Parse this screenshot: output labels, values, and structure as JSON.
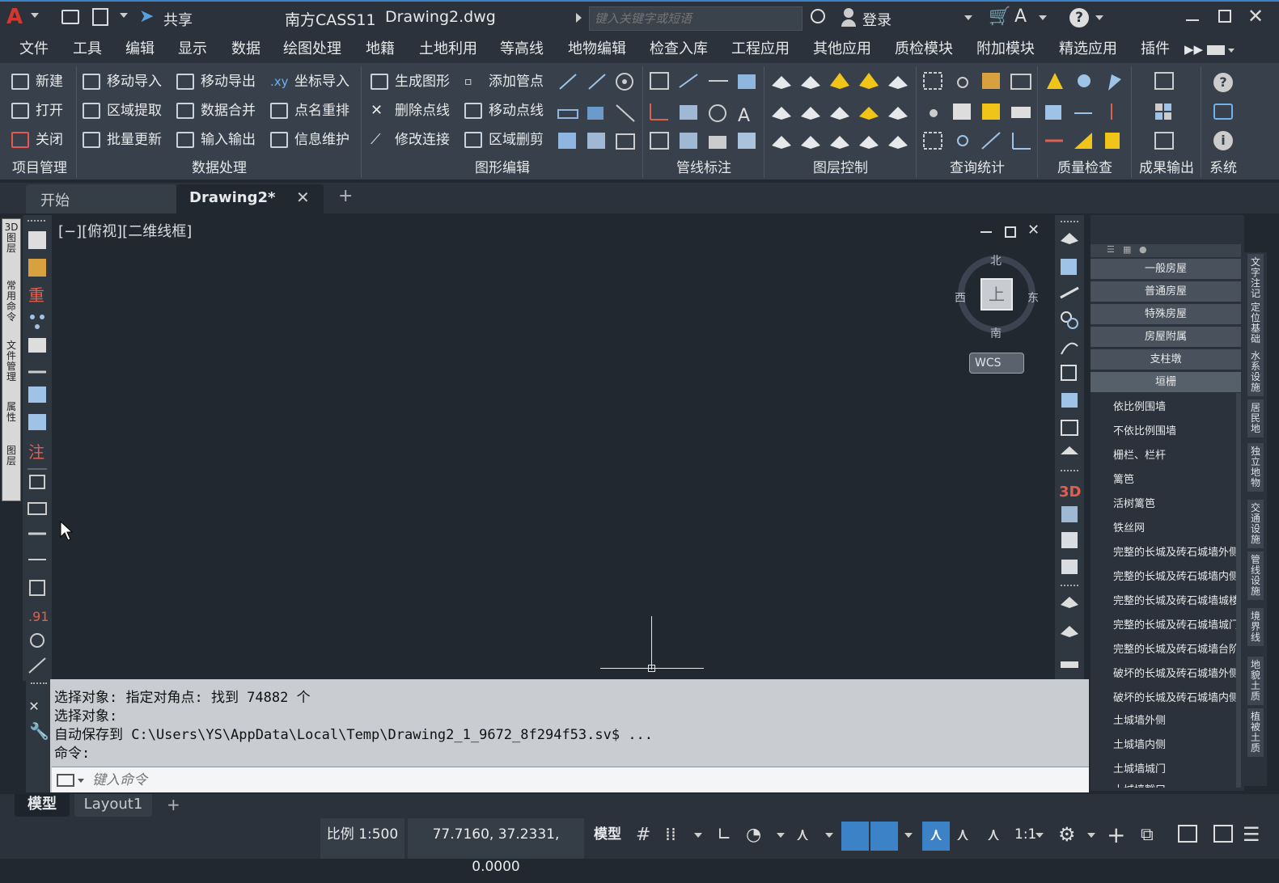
{
  "app": {
    "product": "南方CASS11",
    "document": "Drawing2.dwg",
    "share": "共享",
    "search_placeholder": "键入关键字或短语",
    "login": "登录"
  },
  "menu": [
    "文件",
    "工具",
    "编辑",
    "显示",
    "数据",
    "绘图处理",
    "地籍",
    "土地利用",
    "等高线",
    "地物编辑",
    "检查入库",
    "工程应用",
    "其他应用",
    "质检模块",
    "附加模块",
    "精选应用",
    "插件"
  ],
  "ribbon": {
    "project": {
      "new": "新建",
      "open": "打开",
      "close": "关闭",
      "group": "项目管理"
    },
    "data": {
      "move_import": "移动导入",
      "region_extract": "区域提取",
      "batch_update": "批量更新",
      "move_export": "移动导出",
      "data_merge": "数据合并",
      "io": "输入输出",
      "coord_import": "坐标导入",
      "point_rename": "点名重排",
      "info_maint": "信息维护",
      "coord_prefix": ".xy",
      "group": "数据处理"
    },
    "graph": {
      "gen_shape": "生成图形",
      "delete_pl": "删除点线",
      "modify_link": "修改连接",
      "add_pipe": "添加管点",
      "move_pl": "移动点线",
      "region_cut": "区域删剪",
      "group": "图形编辑"
    },
    "groups": {
      "pipe": "管线标注",
      "layer": "图层控制",
      "query": "查询统计",
      "quality": "质量检查",
      "output": "成果输出",
      "system": "系统"
    }
  },
  "tabs": {
    "start": "开始",
    "drawing": "Drawing2*",
    "add": "+"
  },
  "viewport": {
    "label": "[−][俯视][二维线框]",
    "north": "北",
    "south": "南",
    "east": "东",
    "west": "西",
    "top": "上",
    "wcs": "WCS"
  },
  "left_vtabs": [
    "图层",
    "属性",
    "文件管理",
    "常用命令",
    "3D图层"
  ],
  "panel": {
    "categories": [
      "一般房屋",
      "普通房屋",
      "特殊房屋",
      "房屋附属",
      "支柱墩",
      "垣栅"
    ],
    "items": [
      "依比例围墙",
      "不依比例围墙",
      "栅栏、栏杆",
      "篱笆",
      "活树篱笆",
      "铁丝网",
      "完整的长城及砖石城墙外侧",
      "完整的长城及砖石城墙内侧",
      "完整的长城及砖石城墙城楼",
      "完整的长城及砖石城墙城门",
      "完整的长城及砖石城墙台阶",
      "破坏的长城及砖石城墙外侧",
      "破坏的长城及砖石城墙内侧",
      "土城墙外侧",
      "土城墙内侧",
      "土城墙城门",
      "土城墙豁口"
    ],
    "vtabs": [
      "文字注记",
      "定位基础",
      "水系设施",
      "居民地",
      "独立地物",
      "交通设施",
      "管线设施",
      "境界线",
      "地貌土质",
      "植被土质"
    ]
  },
  "command": {
    "lines": [
      "选择对象: 指定对角点: 找到 74882 个",
      "选择对象:",
      "自动保存到 C:\\Users\\YS\\AppData\\Local\\Temp\\Drawing2_1_9672_8f294f53.sv$ ...",
      "命令:"
    ],
    "placeholder": "键入命令"
  },
  "layouts": {
    "model": "模型",
    "layout1": "Layout1",
    "add": "+"
  },
  "status": {
    "scale": "比例 1:500",
    "coords": "77.7160, 37.2331, 0.0000",
    "space": "模型",
    "annoscale": "1:1"
  },
  "colors": {
    "accent": "#3b83c6",
    "bg": "#212830",
    "chrome": "#2b323b"
  }
}
